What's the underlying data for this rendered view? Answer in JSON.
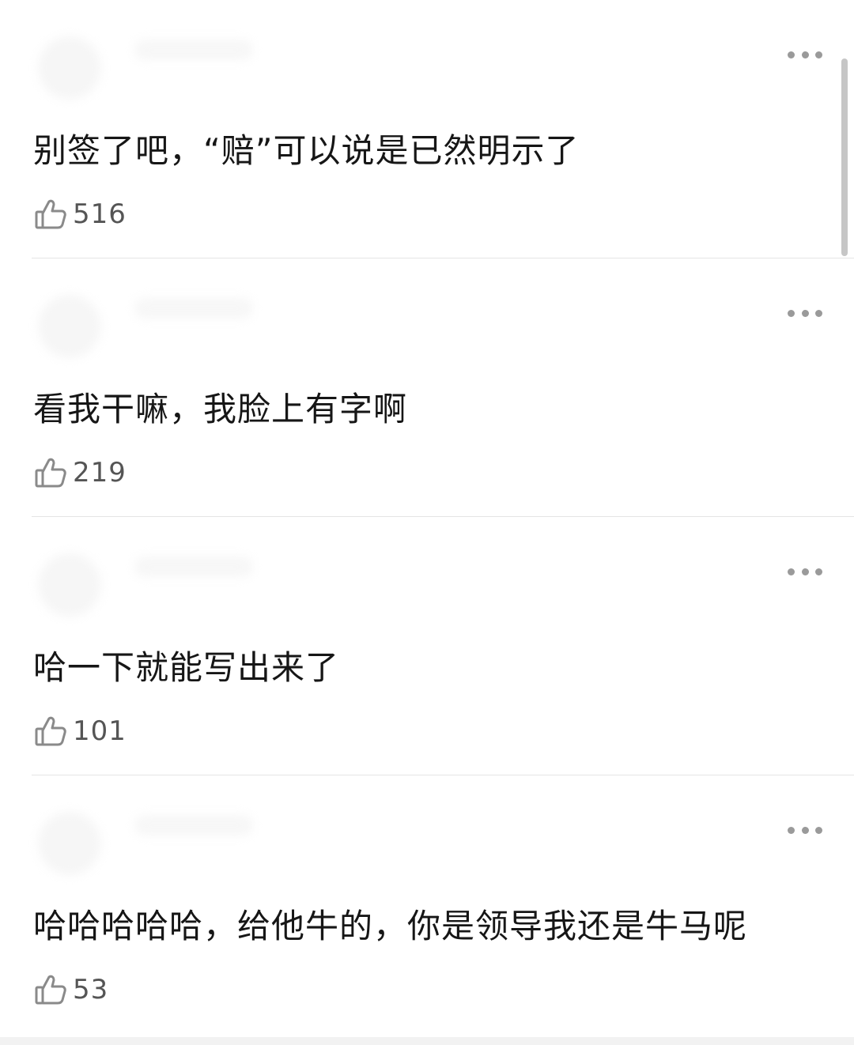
{
  "comments": [
    {
      "text": "别签了吧，“赔”可以说是已然明示了",
      "likes": "516"
    },
    {
      "text": "看我干嘛，我脸上有字啊",
      "likes": "219"
    },
    {
      "text": "哈一下就能写出来了",
      "likes": "101"
    },
    {
      "text": "哈哈哈哈哈，给他牛的，你是领导我还是牛马呢",
      "likes": "53"
    }
  ],
  "icons": {
    "more": "more-horizontal-icon",
    "like": "thumbs-up-icon"
  },
  "colors": {
    "text": "#161616",
    "like_count": "#555555",
    "icon": "#8a8a8a",
    "divider": "#e4e4e4",
    "background": "#ffffff"
  }
}
